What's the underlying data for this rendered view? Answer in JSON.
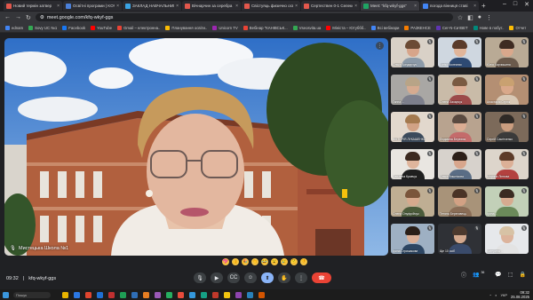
{
  "browser": {
    "tabs": [
      {
        "label": "Новий термін затвер",
        "color": "#e2574c",
        "active": false
      },
      {
        "label": "Освітні програми | KOV",
        "color": "#4a7fd8",
        "active": false
      },
      {
        "label": "ЗАКЛАД НАВЧАЛЬНИЙ",
        "color": "#3aa3e3",
        "active": false
      },
      {
        "label": "Вічнарчин за серебра",
        "color": "#e2574c",
        "active": false
      },
      {
        "label": "Свістуяць физично осв",
        "color": "#e2574c",
        "active": false
      },
      {
        "label": "Сертествен 0-1 Селекс",
        "color": "#e2574c",
        "active": false
      },
      {
        "label": "Meet: \"kfq-wkyf-ggs\"",
        "color": "#1fa463",
        "active": true
      },
      {
        "label": "погода вінниця ставі",
        "color": "#4285f4",
        "active": false
      }
    ],
    "new_tab": "+",
    "window_controls": [
      "–",
      "□",
      "✕"
    ],
    "url": "meet.google.com/kfq-wkyf-ggs",
    "bookmarks": [
      {
        "label": "ednam",
        "color": "#4285f4"
      },
      {
        "label": "Sovy UC №1",
        "color": "#34a853"
      },
      {
        "label": "Facebook",
        "color": "#1877f2"
      },
      {
        "label": "YouTube",
        "color": "#ff0000"
      },
      {
        "label": "Gmail – електронна..",
        "color": "#ea4335"
      },
      {
        "label": "Планування освіти..",
        "color": "#fbbc04"
      },
      {
        "label": "Unicorn TV",
        "color": "#9c27b0"
      },
      {
        "label": "Вебінар \"КАНІВСЬК...",
        "color": "#ea4335"
      },
      {
        "label": "Vseosvita.ua",
        "color": "#34a853"
      },
      {
        "label": "Мініста – Ютуббб..",
        "color": "#ff0000"
      },
      {
        "label": "Всі вебінари",
        "color": "#4285f4"
      },
      {
        "label": "РАЗКЕНСЕ",
        "color": "#f57c00"
      },
      {
        "label": "Cer-N-СитВЕТ",
        "color": "#5e35b1"
      },
      {
        "label": "Нове в побут..",
        "color": "#00897b"
      },
      {
        "label": "Отчет",
        "color": "#fbbc04"
      }
    ]
  },
  "meet": {
    "main_speaker_label": "Мистецька Школа №1",
    "participants": [
      {
        "name": "Ольга Бондарчук",
        "skin": "#d7a58a",
        "hair": "#6b4b35",
        "shirt": "#8c9aa8",
        "bg": "#d9d1c7"
      },
      {
        "name": "Lariso Колесник",
        "skin": "#e0b59a",
        "hair": "#5a3b2a",
        "shirt": "#2e4a73",
        "bg": "#cfd7e0"
      },
      {
        "name": "Юлія Харчишина",
        "skin": "#d9a88c",
        "hair": "#3e2b22",
        "shirt": "#6b5a4c",
        "bg": "#b9aa95"
      },
      {
        "name": "Ганна ...",
        "skin": "#d6ab90",
        "hair": "#b8a487",
        "shirt": "#7d7f8c",
        "bg": "#a9a7a4"
      },
      {
        "name": "Олена Захарчук",
        "skin": "#dcae95",
        "hair": "#7a5a42",
        "shirt": "#9c4a4a",
        "bg": "#c9bba8"
      },
      {
        "name": "Анастасія Стрюк",
        "skin": "#d9a88a",
        "hair": "#c9a171",
        "shirt": "#d8c8b5",
        "bg": "#b48f73"
      },
      {
        "name": "ВІКТОРІЯ ЛУКАШЕНКО",
        "skin": "#d1a285",
        "hair": "#a3794e",
        "shirt": "#3c4b5c",
        "bg": "#e2d8cd"
      },
      {
        "name": "Людмила Березюк",
        "skin": "#dbad93",
        "hair": "#5a4a40",
        "shirt": "#c46b6b",
        "bg": "#b8a38f"
      },
      {
        "name": "Сергій Самітченко",
        "skin": "#ca9d7f",
        "hair": "#2f2a26",
        "shirt": "#3a3a3a",
        "bg": "#7c6a5a"
      },
      {
        "name": "Світлана Кравчук",
        "skin": "#dfb59c",
        "hair": "#3c2a20",
        "shirt": "#1f1f1f",
        "bg": "#e9e6e1"
      },
      {
        "name": "Ольга Вишнікова",
        "skin": "#d8a68c",
        "hair": "#2c1f18",
        "shirt": "#5a6d85",
        "bg": "#d7d2cc"
      },
      {
        "name": "Марина Ліпнова",
        "skin": "#dcb097",
        "hair": "#5d3b29",
        "shirt": "#b3413f",
        "bg": "#ddd5cb"
      },
      {
        "name": "Олена Онуфрійчук",
        "skin": "#d6a98d",
        "hair": "#7a553b",
        "shirt": "#4b5b3a",
        "bg": "#bfae93"
      },
      {
        "name": "Тетяна Береговець",
        "skin": "#d2a184",
        "hair": "#4a3326",
        "shirt": "#8a6d57",
        "bg": "#a89379"
      },
      {
        "name": "Ірина ...",
        "skin": "#d7ab90",
        "hair": "#3a2b22",
        "shirt": "#6b8a5a",
        "bg": "#c2d0b8"
      },
      {
        "name": "Ірина Стрижакова",
        "skin": "#dcb097",
        "hair": "#2b1f18",
        "shirt": "#2d4663",
        "bg": "#9eb0c3"
      },
      {
        "name": "Ще 10 осіб",
        "skin": "#d4a98e",
        "hair": "#4d3a2e",
        "shirt": "#3a4b6b",
        "bg": "#2f3136"
      },
      {
        "name": "Катерина ...",
        "skin": "#dcb39b",
        "hair": "#d7c2a5",
        "shirt": "#e3e3e3",
        "bg": "#e6e8eb"
      }
    ],
    "reactions": [
      "💖",
      "👍",
      "🎉",
      "👏",
      "😂",
      "😮",
      "😢",
      "🤔",
      "👎"
    ],
    "time": "09:32",
    "meeting_code": "kfq-wkyf-ggs",
    "controls": [
      {
        "name": "mic-button",
        "icon": "🎙"
      },
      {
        "name": "camera-button",
        "icon": "▶"
      },
      {
        "name": "captions-button",
        "icon": "CC"
      },
      {
        "name": "reactions-button",
        "icon": "☺"
      },
      {
        "name": "present-button",
        "icon": "⬆"
      },
      {
        "name": "raise-hand-button",
        "icon": "✋"
      },
      {
        "name": "more-options-button",
        "icon": "⋮"
      }
    ],
    "end_call_icon": "☎",
    "participant_count": "36",
    "right_icons": [
      "ⓘ",
      "👥",
      "💬",
      "⬚",
      "🔒"
    ]
  },
  "taskbar": {
    "search_placeholder": "Пошук",
    "apps": [
      "#e8b400",
      "#2b78e4",
      "#e0452e",
      "#1f6fd1",
      "#c13030",
      "#1f9e55",
      "#2f6eb5",
      "#e67e22",
      "#9b59b6",
      "#27ae60",
      "#e74c3c",
      "#3498db",
      "#16a085",
      "#c0392b",
      "#f1c40f",
      "#8e44ad",
      "#2980b9",
      "#d35400"
    ],
    "language": "УКР",
    "time": "09:32",
    "date": "25.08.2025"
  }
}
